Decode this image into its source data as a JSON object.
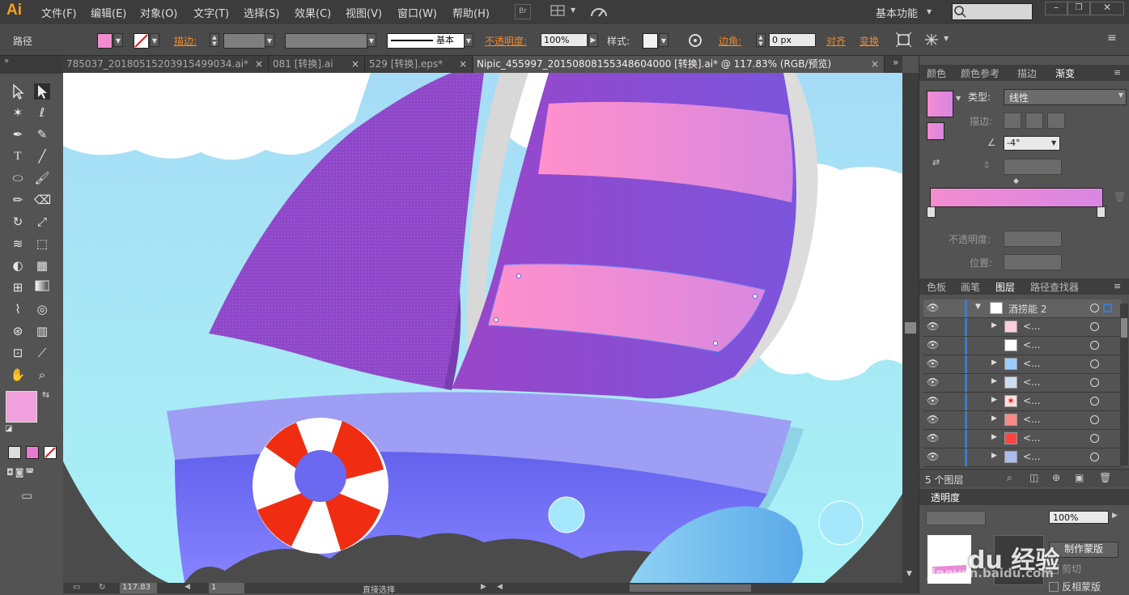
{
  "app": {
    "logo": "Ai",
    "menu": [
      "文件(F)",
      "编辑(E)",
      "对象(O)",
      "文字(T)",
      "选择(S)",
      "效果(C)",
      "视图(V)",
      "窗口(W)",
      "帮助(H)"
    ],
    "br_label": "Br",
    "workspace": "基本功能",
    "search_placeholder": ""
  },
  "control_bar": {
    "selection_label": "路径",
    "stroke_label": "描边:",
    "stroke_style": "基本",
    "opacity_label": "不透明度:",
    "opacity_value": "100%",
    "style_label": "样式:",
    "corner_label": "边角:",
    "corner_value": "0 px",
    "align_label": "对齐",
    "transform_label": "变换"
  },
  "tabs": [
    {
      "label": "785037_20180515203915499034.ai*"
    },
    {
      "label": "081 [转换].ai"
    },
    {
      "label": "529 [转换].eps*"
    },
    {
      "label": "Nipic_455997_20150808155348604000 [转换].ai* @ 117.83% (RGB/预览)"
    }
  ],
  "tab_close": "×",
  "overflow_glyph": "»",
  "gradient_panel": {
    "tabs": [
      "颜色",
      "颜色参考",
      "描边",
      "渐变"
    ],
    "type_label": "类型:",
    "type_value": "线性",
    "stroke_label": "描边:",
    "angle_value": "-4°",
    "opacity_label": "不透明度:",
    "position_label": "位置:",
    "colors": {
      "start": "#f28ccf",
      "end": "#d986e3"
    }
  },
  "layers_panel": {
    "tabs": [
      "色板",
      "画笔",
      "图层",
      "路径查找器"
    ],
    "layer_name": "酒捞能 2",
    "sublayer_name": "<...",
    "count_label": "5 个图层"
  },
  "transparency_panel": {
    "title": "透明度",
    "opacity_value": "100%",
    "mask_button": "制作蒙版",
    "clip_label": "剪切",
    "invert_label": "反相蒙版"
  },
  "status": {
    "zoom": "117.83",
    "page": "1",
    "tool": "直接选择"
  },
  "watermark": {
    "text": "du 经验",
    "sub": "jingyan.baidu.com"
  },
  "colors": {
    "fill_swatch": "#f28ccf",
    "sky": "#9ee6f7",
    "sail_purple": "#8f47c9",
    "hull_top": "#9d9ef4",
    "hull": "#6462ed",
    "buoy_red": "#f02d12",
    "accent": "#f7a11c"
  }
}
